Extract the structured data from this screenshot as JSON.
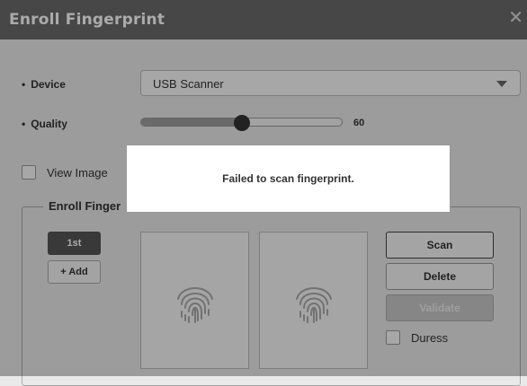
{
  "dialog": {
    "title": "Enroll Fingerprint",
    "close_icon": "close-icon"
  },
  "device": {
    "label": "Device",
    "value": "USB Scanner"
  },
  "quality": {
    "label": "Quality",
    "value": "60",
    "fraction": 0.5
  },
  "view_image": {
    "label": "View Image",
    "checked": false
  },
  "enroll_group": {
    "title": "Enroll Finger",
    "fingers": [
      "1st"
    ],
    "add_label": "+ Add",
    "panel_icon": "fingerprint-icon"
  },
  "actions": {
    "scan": "Scan",
    "delete": "Delete",
    "validate": "Validate",
    "duress_label": "Duress"
  },
  "message": "Failed to scan fingerprint.",
  "colors": {
    "titlebar": "#6b6b6b",
    "selected_finger": "#555555",
    "overlay": "rgba(0,0,0,0.33)"
  }
}
